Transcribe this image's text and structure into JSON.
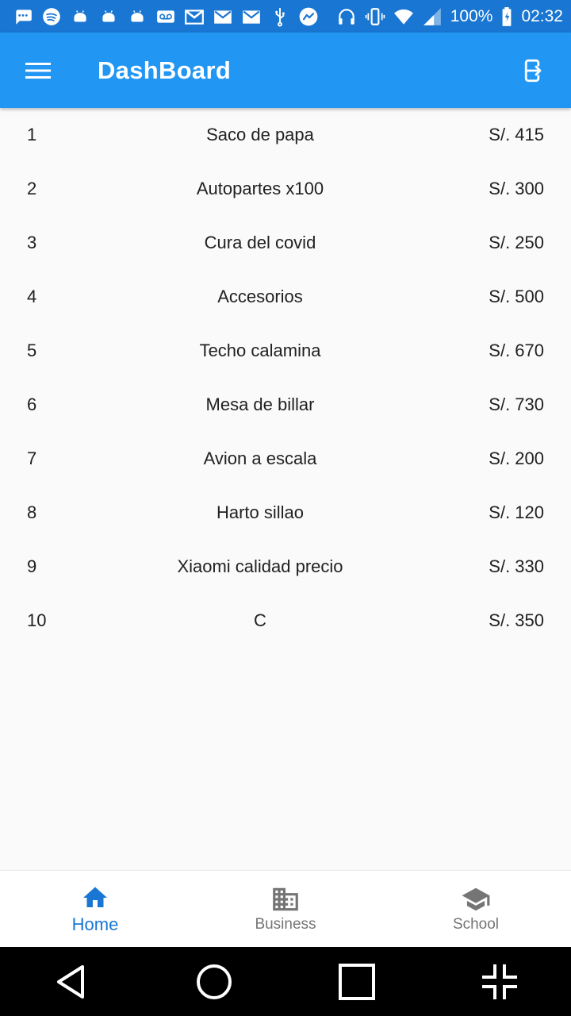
{
  "status_bar": {
    "battery": "100%",
    "time": "02:32",
    "left_icons": [
      "chat-icon",
      "spotify-icon",
      "android-icon",
      "android-icon",
      "android-icon",
      "voicemail-icon",
      "gmail-icon",
      "gmail-icon",
      "gmail-icon",
      "usb-icon",
      "messenger-icon"
    ],
    "right_icons": [
      "headphones-icon",
      "vibrate-icon",
      "wifi-icon",
      "signal-icon",
      "battery-icon"
    ]
  },
  "app_bar": {
    "title": "DashBoard",
    "menu_icon": "menu-icon",
    "logout_icon": "exit-icon"
  },
  "items": [
    {
      "index": "1",
      "name": "Saco de papa",
      "price": "S/. 415"
    },
    {
      "index": "2",
      "name": "Autopartes x100",
      "price": "S/. 300"
    },
    {
      "index": "3",
      "name": "Cura del covid",
      "price": "S/. 250"
    },
    {
      "index": "4",
      "name": "Accesorios",
      "price": "S/. 500"
    },
    {
      "index": "5",
      "name": "Techo calamina",
      "price": "S/. 670"
    },
    {
      "index": "6",
      "name": "Mesa de billar",
      "price": "S/. 730"
    },
    {
      "index": "7",
      "name": "Avion a escala",
      "price": "S/. 200"
    },
    {
      "index": "8",
      "name": "Harto sillao",
      "price": "S/. 120"
    },
    {
      "index": "9",
      "name": "Xiaomi calidad precio",
      "price": "S/. 330"
    },
    {
      "index": "10",
      "name": "C",
      "price": "S/. 350"
    }
  ],
  "bottom_nav": {
    "items": [
      {
        "label": "Home",
        "icon": "home-icon",
        "active": true
      },
      {
        "label": "Business",
        "icon": "business-icon",
        "active": false
      },
      {
        "label": "School",
        "icon": "school-icon",
        "active": false
      }
    ]
  },
  "system_nav": {
    "buttons": [
      "back-icon",
      "home-circle-icon",
      "recents-icon",
      "collapse-icon"
    ]
  },
  "colors": {
    "status_bar": "#1976d2",
    "app_bar": "#2196f3",
    "active_nav": "#1976d2",
    "inactive_nav": "#757575",
    "background": "#fafafa"
  }
}
